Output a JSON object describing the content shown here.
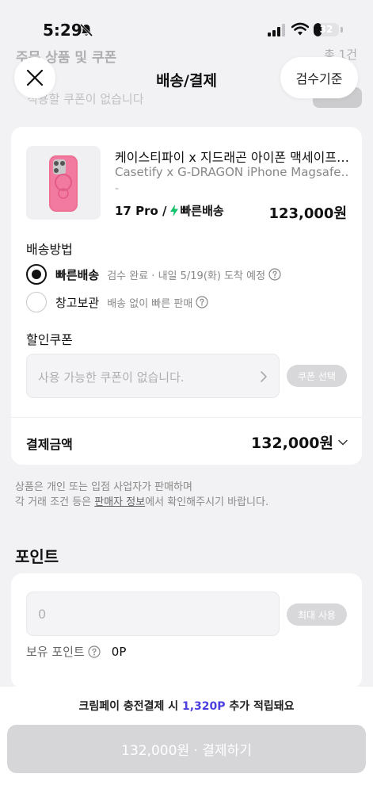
{
  "status_bar": {
    "time": "5:29",
    "battery": "32",
    "battery_level": 0.32
  },
  "background": {
    "title": "주문 상품 및 쿠폰",
    "count": "총 1건",
    "coupon_note": "적용할 쿠폰이 없습니다"
  },
  "nav": {
    "title": "배송/결제",
    "inspect_label": "검수기준"
  },
  "product": {
    "name": "케이스티파이 x 지드래곤 아이폰 맥세이프…",
    "sub_name": "Casetify x G-DRAGON iPhone Magsafe…",
    "dash": "-",
    "option": "17 Pro /",
    "shipping_badge": "빠른배송",
    "price": "123,000원"
  },
  "shipping": {
    "label": "배송방법",
    "options": [
      {
        "label": "빠른배송",
        "desc": "검수 완료 · 내일 5/19(화) 도착 예정",
        "selected": true
      },
      {
        "label": "창고보관",
        "desc": "배송 없이 빠른 판매",
        "selected": false
      }
    ]
  },
  "coupon": {
    "label": "할인쿠폰",
    "placeholder": "사용 가능한 쿠폰이 없습니다.",
    "button": "쿠폰 선택"
  },
  "payment": {
    "label": "결제금액",
    "amount": "132,000원"
  },
  "notice": {
    "line1": "상품은 개인 또는 입점 사업자가 판매하며",
    "line2_prefix": "각 거래 조건 등은 ",
    "line2_link": "판매자 정보",
    "line2_suffix": "에서 확인해주시기 바랍니다."
  },
  "points": {
    "title": "포인트",
    "input_value": "0",
    "max_button": "최대 사용",
    "owned_label": "보유 포인트",
    "owned_value": "0P"
  },
  "bottom": {
    "promo_prefix": "크림페이 충전결제 시 ",
    "promo_points": "1,320P",
    "promo_suffix": " 추가 적립돼요",
    "pay_button": "132,000원 · 결제하기"
  },
  "colors": {
    "accent": "#4b3fe0",
    "bolt": "#12c26b",
    "case_pink": "#ee6f92",
    "disabled": "#d6d6d8"
  },
  "icons": [
    "bell-slash-icon",
    "signal-icon",
    "wifi-icon",
    "close-icon",
    "bolt-icon",
    "help-icon",
    "chevron-right-icon",
    "chevron-down-icon"
  ]
}
